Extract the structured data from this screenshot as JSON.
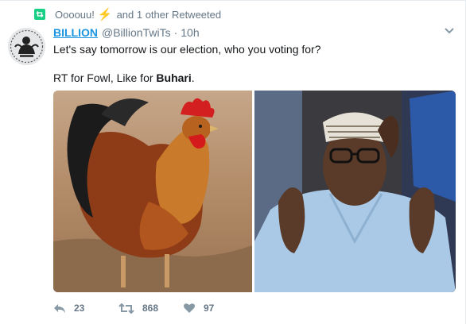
{
  "retweet_context": {
    "user": "Oooouu!",
    "bolt": "⚡",
    "rest": "and 1 other Retweeted",
    "icon": "retweet-icon"
  },
  "tweet": {
    "display_name": "BILLION",
    "handle": "@BillionTwiTs",
    "separator": "·",
    "time": "10h",
    "text_line1": "Let's say tomorrow is our election, who you voting for?",
    "text_line2_prefix": "RT for Fowl, Like for ",
    "text_line2_bold": "Buhari",
    "text_line2_suffix": "."
  },
  "actions": {
    "reply_count": "23",
    "retweet_count": "868",
    "like_count": "97"
  },
  "colors": {
    "link_blue": "#1b95e0",
    "muted": "#657786",
    "retweet_green": "#19cf86"
  }
}
